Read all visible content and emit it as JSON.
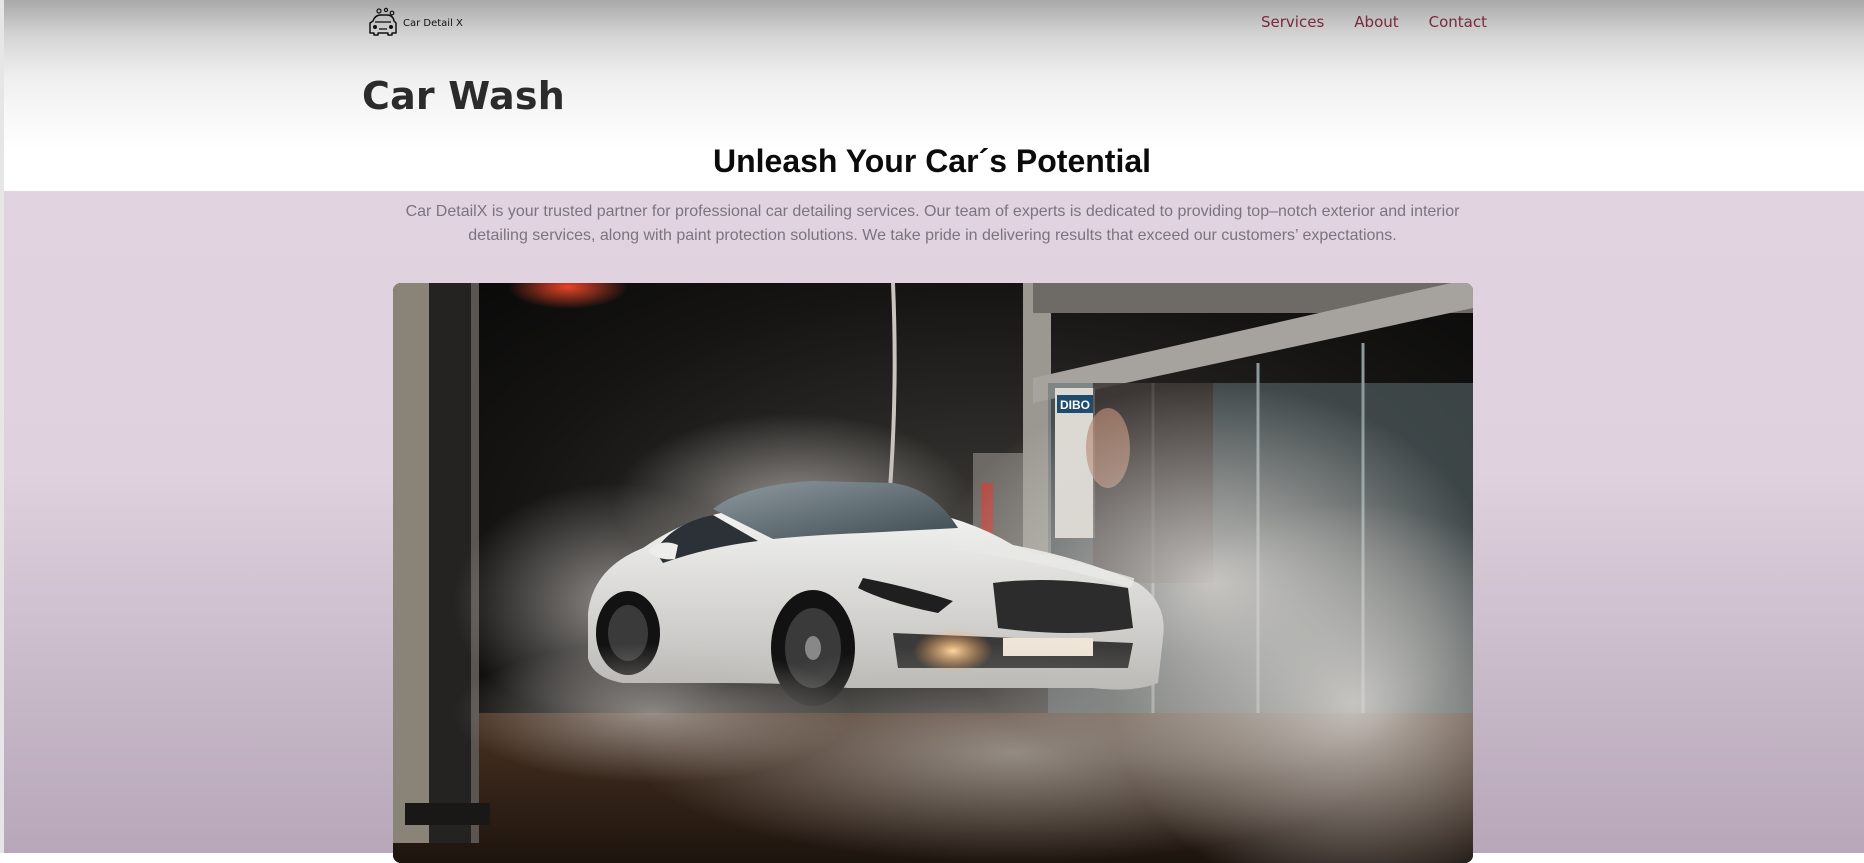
{
  "header": {
    "brand_name": "Car Detail X",
    "logo_icon": "car-wash-logo-icon",
    "nav": [
      {
        "label": "Services"
      },
      {
        "label": "About"
      },
      {
        "label": "Contact"
      }
    ]
  },
  "main": {
    "title": "Car Wash",
    "headline": "Unleash Your Car´s Potential",
    "description": "Car DetailX is your trusted partner for professional car detailing services. Our team of experts is dedicated to providing top–notch exterior and interior detailing services, along with paint protection solutions. We take pride in delivering results that exceed our customers’ expectations.",
    "hero_image_sign": "DIBO"
  },
  "colors": {
    "nav_link": "#7a2a3c",
    "hero_band": "#e1d3df",
    "title": "#2b2b2b",
    "headline": "#0b0b0b",
    "body_text": "#7b7480"
  }
}
